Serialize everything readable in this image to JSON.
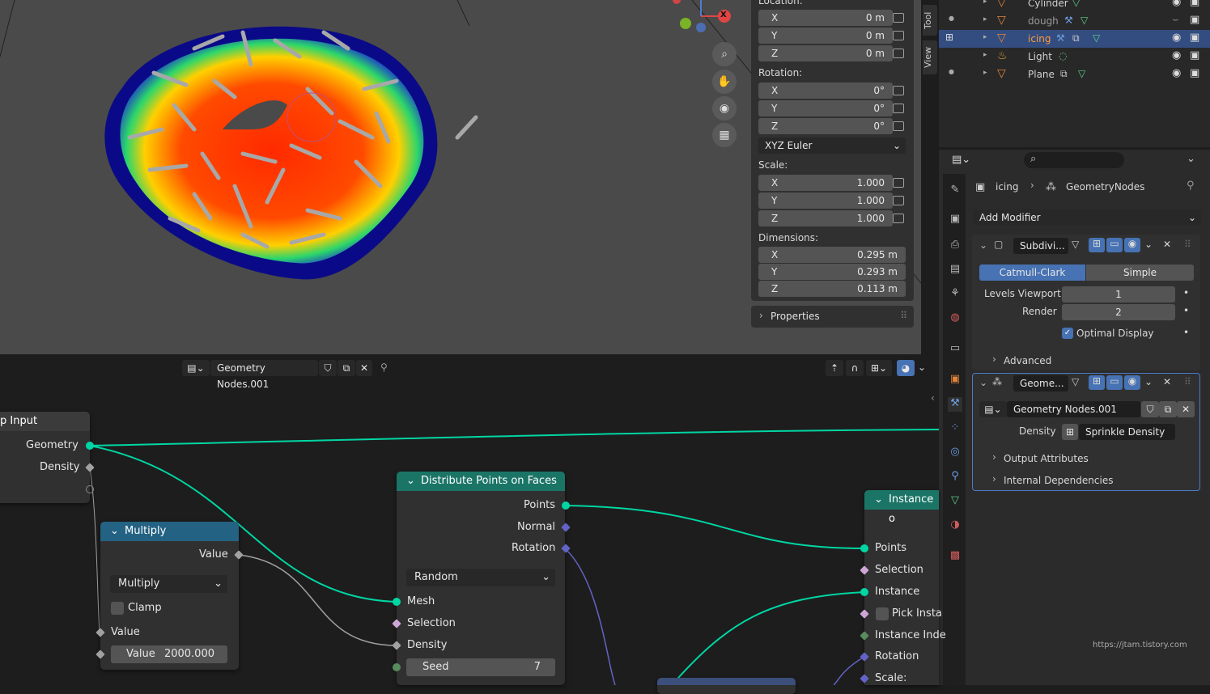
{
  "viewport": {
    "tabs": {
      "tool": "Tool",
      "view": "View"
    },
    "npanel": {
      "location_label": "Location:",
      "location": [
        {
          "axis": "X",
          "value": "0 m"
        },
        {
          "axis": "Y",
          "value": "0 m"
        },
        {
          "axis": "Z",
          "value": "0 m"
        }
      ],
      "rotation_label": "Rotation:",
      "rotation": [
        {
          "axis": "X",
          "value": "0°"
        },
        {
          "axis": "Y",
          "value": "0°"
        },
        {
          "axis": "Z",
          "value": "0°"
        }
      ],
      "rotation_mode": "XYZ Euler",
      "scale_label": "Scale:",
      "scale": [
        {
          "axis": "X",
          "value": "1.000"
        },
        {
          "axis": "Y",
          "value": "1.000"
        },
        {
          "axis": "Z",
          "value": "1.000"
        }
      ],
      "dimensions_label": "Dimensions:",
      "dimensions": [
        {
          "axis": "X",
          "value": "0.295 m"
        },
        {
          "axis": "Y",
          "value": "0.293 m"
        },
        {
          "axis": "Z",
          "value": "0.113 m"
        }
      ],
      "properties_label": "Properties"
    },
    "gizmo": {
      "x_label": "X"
    }
  },
  "outliner": {
    "rows": [
      {
        "name": "Cylinder",
        "icon": "mesh-icon"
      },
      {
        "name": "dough",
        "icon": "mesh-icon"
      },
      {
        "name": "icing",
        "icon": "mesh-icon"
      },
      {
        "name": "Light",
        "icon": "light-icon"
      },
      {
        "name": "Plane",
        "icon": "mesh-icon"
      }
    ]
  },
  "properties": {
    "breadcrumb": {
      "object": "icing",
      "modifier": "GeometryNodes"
    },
    "add_modifier": "Add Modifier",
    "subdiv": {
      "name": "Subdivi...",
      "tab_catmull": "Catmull-Clark",
      "tab_simple": "Simple",
      "levels_viewport_label": "Levels Viewport",
      "levels_viewport": "1",
      "render_label": "Render",
      "render": "2",
      "optimal_display": "Optimal Display",
      "advanced": "Advanced"
    },
    "geonodes": {
      "name": "Geome...",
      "node_group": "Geometry Nodes.001",
      "density_label": "Density",
      "density_value": "Sprinkle Density",
      "output_attributes": "Output Attributes",
      "internal_dependencies": "Internal Dependencies"
    },
    "watermark": "https://jtam.tistory.com"
  },
  "node_editor": {
    "node_group": "Geometry Nodes.001",
    "group_input": {
      "title": "p Input",
      "geometry": "Geometry",
      "density": "Density"
    },
    "multiply": {
      "title": "Multiply",
      "out_value": "Value",
      "operation": "Multiply",
      "clamp": "Clamp",
      "in_value": "Value",
      "value_label": "Value",
      "value": "2000.000"
    },
    "distribute": {
      "title": "Distribute Points on Faces",
      "points": "Points",
      "normal": "Normal",
      "rotation": "Rotation",
      "mode": "Random",
      "mesh": "Mesh",
      "selection": "Selection",
      "density": "Density",
      "seed_label": "Seed",
      "seed": "7"
    },
    "instance": {
      "title": "Instance o",
      "points": "Points",
      "selection": "Selection",
      "instance": "Instance",
      "pick": "Pick Insta",
      "instance_index": "Instance Inde",
      "rotation": "Rotation",
      "scale": "Scale:"
    }
  }
}
